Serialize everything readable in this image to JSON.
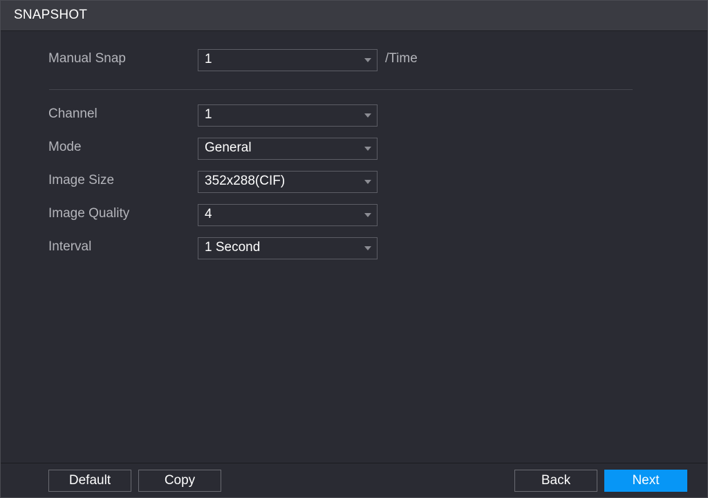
{
  "window": {
    "title": "SNAPSHOT"
  },
  "manual_snap": {
    "label": "Manual Snap",
    "value": "1",
    "suffix": "/Time"
  },
  "fields": [
    {
      "label": "Channel",
      "value": "1"
    },
    {
      "label": "Mode",
      "value": "General"
    },
    {
      "label": "Image Size",
      "value": "352x288(CIF)"
    },
    {
      "label": "Image Quality",
      "value": "4"
    },
    {
      "label": "Interval",
      "value": "1 Second"
    }
  ],
  "buttons": {
    "default": "Default",
    "copy": "Copy",
    "back": "Back",
    "next": "Next"
  },
  "colors": {
    "background": "#2a2b33",
    "titlebar": "#3a3b42",
    "accent": "#0796f6",
    "label_text": "#b4b5bb"
  },
  "icons": {
    "dropdown": "caret-down-icon"
  }
}
